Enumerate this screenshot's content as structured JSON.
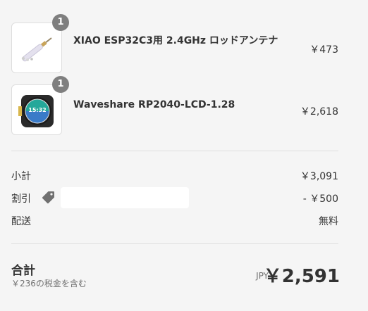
{
  "items": [
    {
      "quantity": "1",
      "name": "XIAO ESP32C3用 2.4GHz ロッドアンテナ",
      "price": "￥473",
      "thumb_icon": "rod-antenna-icon"
    },
    {
      "quantity": "1",
      "name": "Waveshare RP2040-LCD-1.28",
      "price": "￥2,618",
      "thumb_icon": "round-lcd-icon",
      "lcd_time": "15:32"
    }
  ],
  "summary": {
    "subtotal_label": "小計",
    "subtotal_value": "￥3,091",
    "discount_label": "割引",
    "discount_value": "- ￥500",
    "shipping_label": "配送",
    "shipping_value": "無料"
  },
  "total": {
    "label": "合計",
    "tax_note": "￥236の税金を含む",
    "currency": "JPY",
    "amount": "￥2,591"
  },
  "colors": {
    "background": "#f5f5f5",
    "text": "#333333",
    "muted": "#707070",
    "badge": "#7f7f7f",
    "divider": "#dedede"
  }
}
